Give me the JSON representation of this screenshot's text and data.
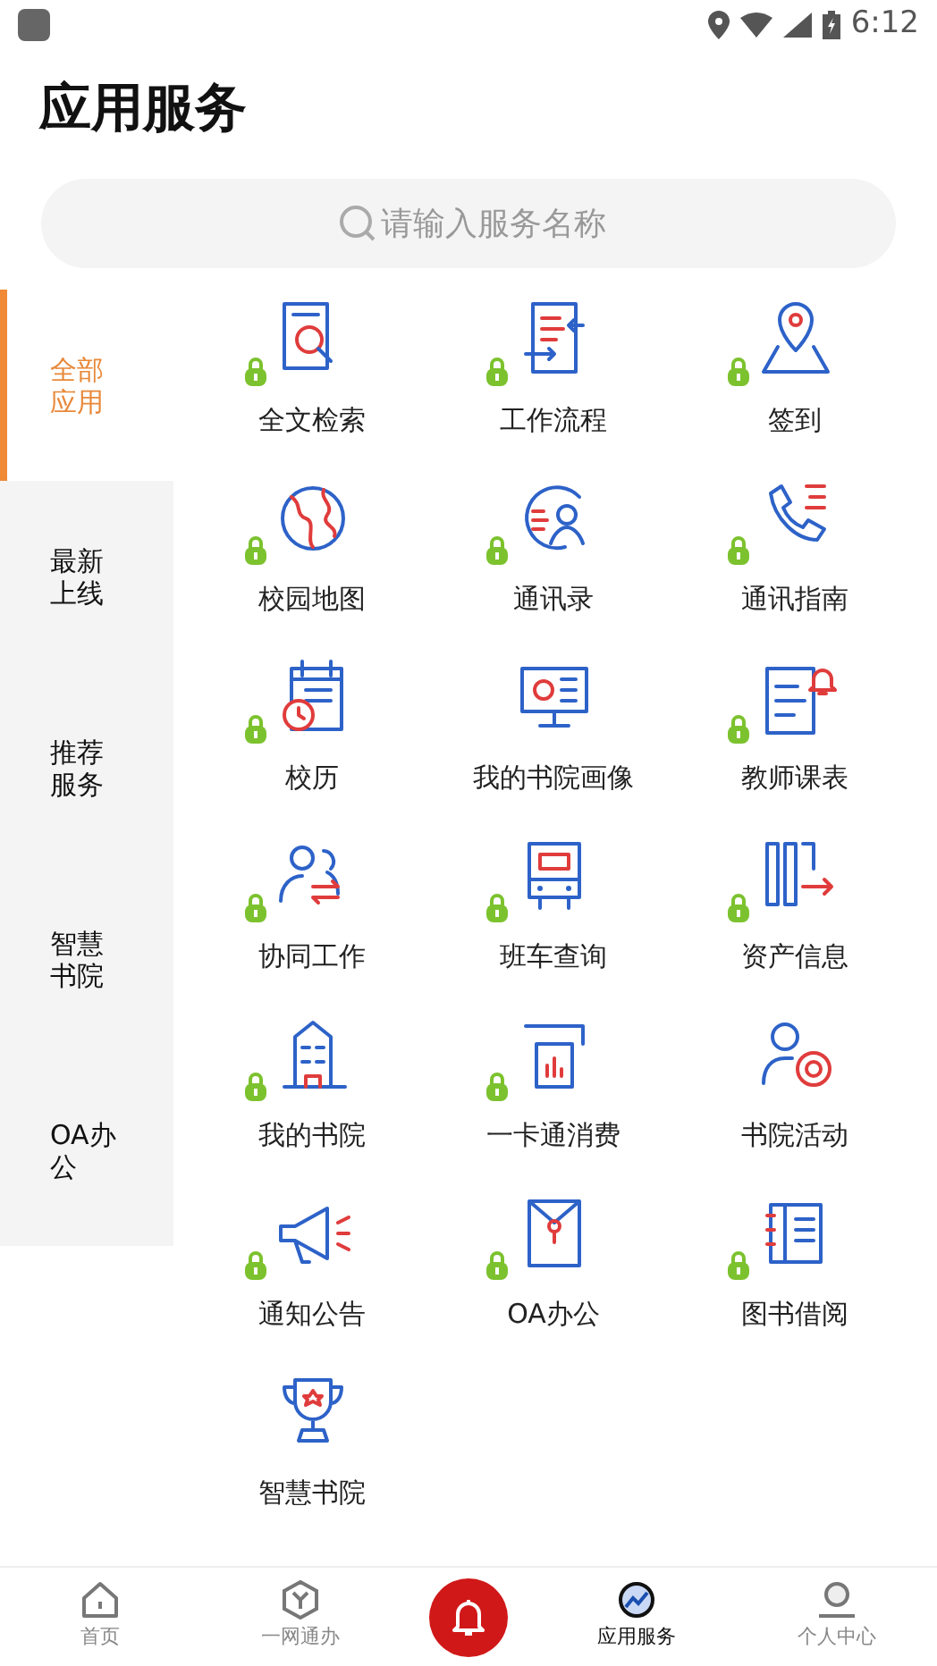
{
  "status_bar": {
    "time": "6:12"
  },
  "title": "应用服务",
  "search": {
    "placeholder": "请输入服务名称"
  },
  "categories": [
    {
      "label": "全部应用",
      "selected": true
    },
    {
      "label": "最新上线",
      "selected": false
    },
    {
      "label": "推荐服务",
      "selected": false
    },
    {
      "label": "智慧书院",
      "selected": false
    },
    {
      "label": "OA办公",
      "selected": false
    }
  ],
  "apps": [
    {
      "label": "全文检索",
      "locked": true
    },
    {
      "label": "工作流程",
      "locked": true
    },
    {
      "label": "签到",
      "locked": true
    },
    {
      "label": "校园地图",
      "locked": true
    },
    {
      "label": "通讯录",
      "locked": true
    },
    {
      "label": "通讯指南",
      "locked": true
    },
    {
      "label": "校历",
      "locked": true
    },
    {
      "label": "我的书院画像",
      "locked": false
    },
    {
      "label": "教师课表",
      "locked": true
    },
    {
      "label": "协同工作",
      "locked": true
    },
    {
      "label": "班车查询",
      "locked": true
    },
    {
      "label": "资产信息",
      "locked": true
    },
    {
      "label": "我的书院",
      "locked": true
    },
    {
      "label": "一卡通消费",
      "locked": true
    },
    {
      "label": "书院活动",
      "locked": false
    },
    {
      "label": "通知公告",
      "locked": true
    },
    {
      "label": "OA办公",
      "locked": true
    },
    {
      "label": "图书借阅",
      "locked": true
    },
    {
      "label": "智慧书院",
      "locked": false
    }
  ],
  "bottom_nav": [
    {
      "kind": "tab",
      "label": "首页",
      "selected": false
    },
    {
      "kind": "tab",
      "label": "一网通办",
      "selected": false
    },
    {
      "kind": "center"
    },
    {
      "kind": "tab",
      "label": "应用服务",
      "selected": true
    },
    {
      "kind": "tab",
      "label": "个人中心",
      "selected": false
    }
  ]
}
